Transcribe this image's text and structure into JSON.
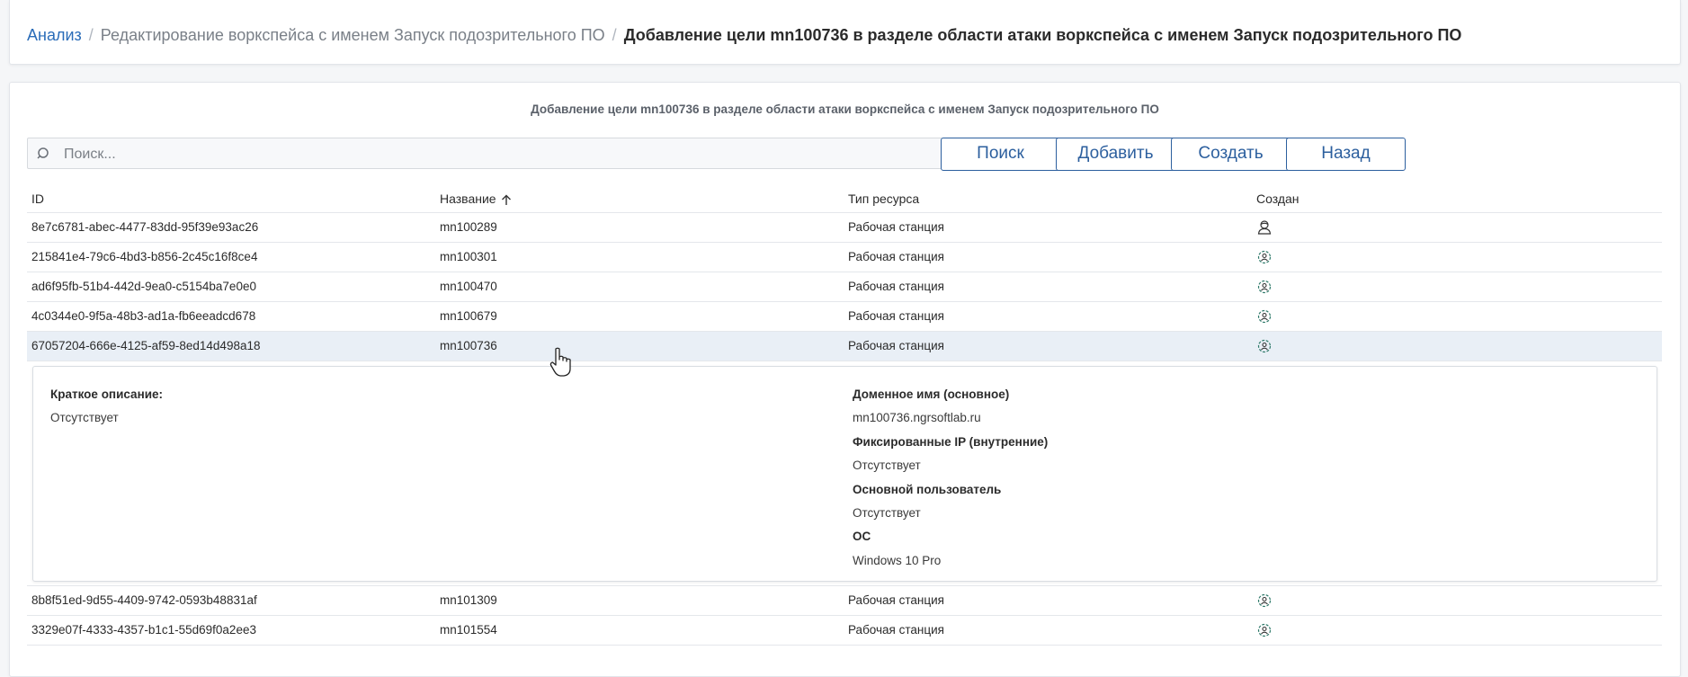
{
  "breadcrumb": {
    "root": "Анализ",
    "middle": "Редактирование воркспейса с именем Запуск подозрительного ПО",
    "current": "Добавление цели mn100736 в разделе области атаки воркспейса с именем Запуск подозрительного ПО"
  },
  "card_title": "Добавление цели mn100736 в разделе области атаки воркспейса с именем Запуск подозрительного ПО",
  "search": {
    "placeholder": "Поиск...",
    "value": ""
  },
  "buttons": {
    "search": "Поиск",
    "add": "Добавить",
    "create": "Создать",
    "back": "Назад"
  },
  "columns": {
    "id": "ID",
    "name": "Название",
    "type": "Тип ресурса",
    "created": "Создан"
  },
  "rows": [
    {
      "id": "8e7c6781-abec-4477-83dd-95f39e93ac26",
      "name": "mn100289",
      "type": "Рабочая станция",
      "created_icon": "user-icon"
    },
    {
      "id": "215841e4-79c6-4bd3-b856-2c45c16f8ce4",
      "name": "mn100301",
      "type": "Рабочая станция",
      "created_icon": "system-gear-icon"
    },
    {
      "id": "ad6f95fb-51b4-442d-9ea0-c5154ba7e0e0",
      "name": "mn100470",
      "type": "Рабочая станция",
      "created_icon": "system-gear-icon"
    },
    {
      "id": "4c0344e0-9f5a-48b3-ad1a-fb6eeadcd678",
      "name": "mn100679",
      "type": "Рабочая станция",
      "created_icon": "system-gear-icon"
    },
    {
      "id": "67057204-666e-4125-af59-8ed14d498a18",
      "name": "mn100736",
      "type": "Рабочая станция",
      "created_icon": "system-gear-icon"
    }
  ],
  "detail": {
    "desc_label": "Краткое описание:",
    "desc_value": "Отсутствует",
    "domain_label": "Доменное имя (основное)",
    "domain_value": "mn100736.ngrsoftlab.ru",
    "ip_label": "Фиксированные IP (внутренние)",
    "ip_value": "Отсутствует",
    "user_label": "Основной пользователь",
    "user_value": "Отсутствует",
    "os_label": "ОС",
    "os_value": "Windows 10 Pro"
  },
  "rows_after": [
    {
      "id": "8b8f51ed-9d55-4409-9742-0593b48831af",
      "name": "mn101309",
      "type": "Рабочая станция",
      "created_icon": "system-gear-icon"
    },
    {
      "id": "3329e07f-4333-4357-b1c1-55d69f0a2ee3",
      "name": "mn101554",
      "type": "Рабочая станция",
      "created_icon": "system-gear-icon"
    }
  ],
  "colors": {
    "link": "#2a6cb8",
    "button": "#2c5f9e",
    "selected_row": "#e9eff6"
  }
}
